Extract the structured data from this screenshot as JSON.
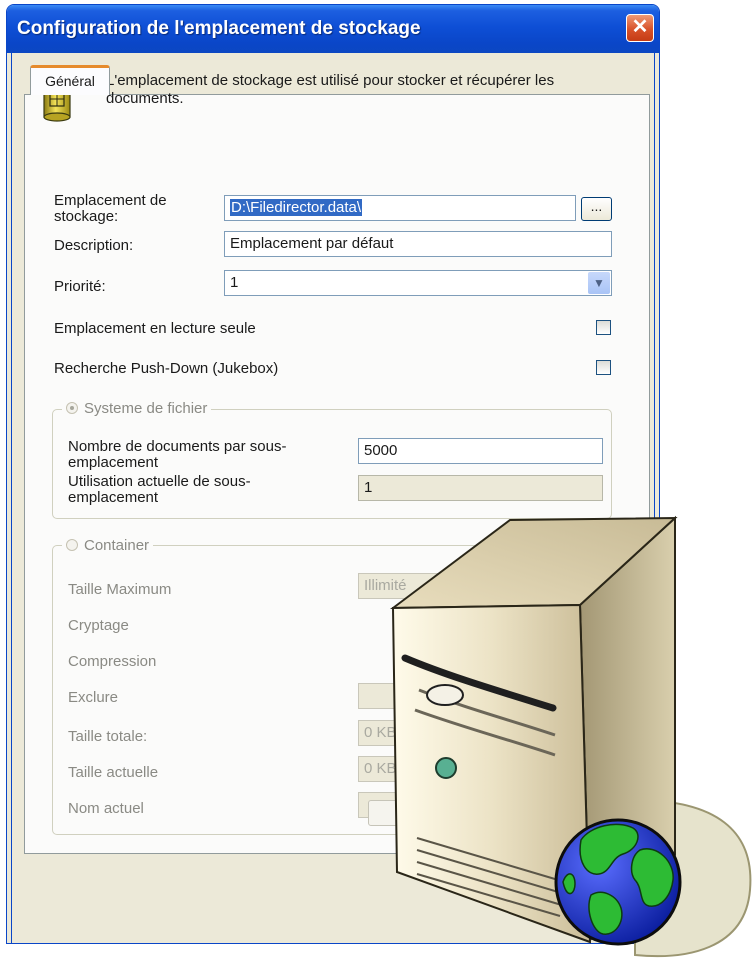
{
  "window": {
    "title": "Configuration de l'emplacement de stockage",
    "close_glyph": "✕"
  },
  "tabs": [
    {
      "label": "Général",
      "active": true
    }
  ],
  "info_text": "L'emplacement de stockage est utilisé pour stocker et récupérer les documents.",
  "storage_location": {
    "label_line1": "Emplacement de",
    "label_line2": "stockage:",
    "value": "D:\\Filedirector.data\\",
    "browse_label": "..."
  },
  "description": {
    "label": "Description:",
    "value": "Emplacement par défaut"
  },
  "priority": {
    "label": "Priorité:",
    "value": "1"
  },
  "read_only": {
    "label": "Emplacement en lecture seule",
    "checked": false
  },
  "push_down": {
    "label": "Recherche Push-Down (Jukebox)",
    "checked": false
  },
  "filesystem_group": {
    "legend": "Systeme de fichier",
    "selected": true,
    "docs_per_sublocation": {
      "label_line1": "Nombre de documents par sous-",
      "label_line2": "emplacement",
      "value": "5000"
    },
    "current_sublocation": {
      "label_line1": "Utilisation actuelle de sous-",
      "label_line2": "emplacement",
      "value": "1"
    }
  },
  "container_group": {
    "legend": "Container",
    "selected": false,
    "max_size": {
      "label": "Taille Maximum",
      "value": "Illimité"
    },
    "encryption": {
      "label": "Cryptage"
    },
    "compression": {
      "label": "Compression"
    },
    "exclude": {
      "label": "Exclure",
      "value": ""
    },
    "total_size": {
      "label": "Taille totale:",
      "value": "0 KB"
    },
    "current_size": {
      "label": "Taille actuelle",
      "value": "0 KB"
    },
    "current_name": {
      "label": "Nom actuel",
      "value": ""
    }
  },
  "icons": {
    "database": "database-icon",
    "server": "server-icon",
    "globe": "globe-icon",
    "dropdown": "chevron-down-icon"
  },
  "colors": {
    "titlebar": "#0a46c8",
    "close_button": "#d8522a",
    "selection": "#316ac5",
    "tab_accent": "#e68b2c"
  }
}
